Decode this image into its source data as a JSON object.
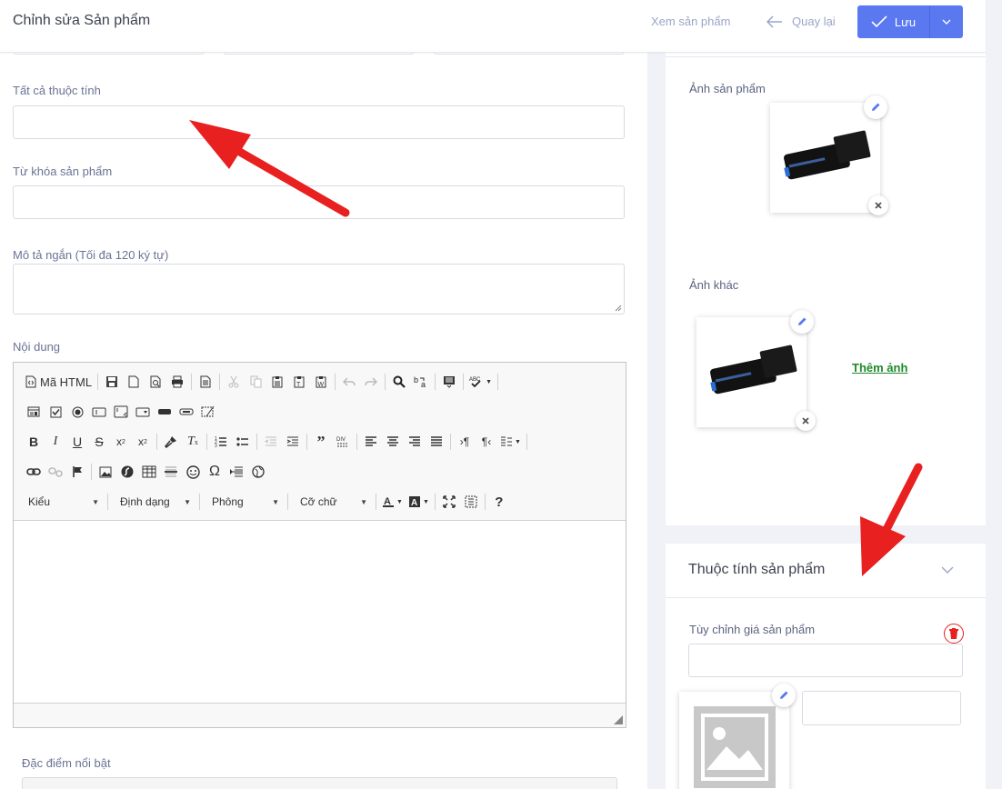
{
  "header": {
    "title": "Chỉnh sửa Sản phẩm",
    "view_product": "Xem sản phẩm",
    "back": "Quay lại",
    "save": "Lưu"
  },
  "form": {
    "all_attributes_label": "Tất cả thuộc tính",
    "keywords_label": "Từ khóa sản phẩm",
    "short_desc_label": "Mô tả ngắn (Tối đa 120 ký tự)",
    "content_label": "Nội dung",
    "highlights_label": "Đặc điểm nổi bật"
  },
  "editor": {
    "source_button": "Mã HTML",
    "combos": [
      "Kiểu",
      "Định dạng",
      "Phông",
      "Cỡ chữ"
    ],
    "row1_icons": [
      "save-icon",
      "new-page-icon",
      "preview-icon",
      "print-icon",
      "templates-icon",
      "cut-icon",
      "copy-icon",
      "paste-icon",
      "paste-text-icon",
      "paste-word-icon",
      "undo-icon",
      "redo-icon",
      "find-icon",
      "replace-icon",
      "select-all-icon",
      "spellcheck-icon"
    ],
    "row2_icons": [
      "form-icon",
      "checkbox-icon",
      "radio-icon",
      "textfield-icon",
      "textarea-icon",
      "select-icon",
      "button-icon",
      "image-button-icon",
      "hidden-field-icon"
    ],
    "row3_icons": [
      "bold-icon",
      "italic-icon",
      "underline-icon",
      "strike-icon",
      "subscript-icon",
      "superscript-icon",
      "copy-format-icon",
      "remove-format-icon",
      "numbered-list-icon",
      "bulleted-list-icon",
      "outdent-icon",
      "indent-icon",
      "blockquote-icon",
      "div-icon",
      "align-left-icon",
      "align-center-icon",
      "align-right-icon",
      "justify-icon",
      "ltr-icon",
      "rtl-icon",
      "language-icon"
    ],
    "row4_icons": [
      "link-icon",
      "unlink-icon",
      "anchor-icon",
      "image-icon",
      "flash-icon",
      "table-icon",
      "horizontal-rule-icon",
      "smiley-icon",
      "special-char-icon",
      "page-break-icon",
      "iframe-icon"
    ],
    "row5_icons": [
      "text-color-icon",
      "bg-color-icon",
      "maximize-icon",
      "show-blocks-icon",
      "help-icon"
    ]
  },
  "media": {
    "product_image_label": "Ảnh sản phẩm",
    "other_images_label": "Ảnh khác",
    "add_image": "Thêm ảnh"
  },
  "attributes_card": {
    "title": "Thuộc tính sản phẩm",
    "custom_price_label": "Tùy chỉnh giá sản phẩm"
  },
  "colors": {
    "primary": "#5a78f0",
    "link_green": "#1c8a2a",
    "annotation_red": "#e8201f"
  }
}
